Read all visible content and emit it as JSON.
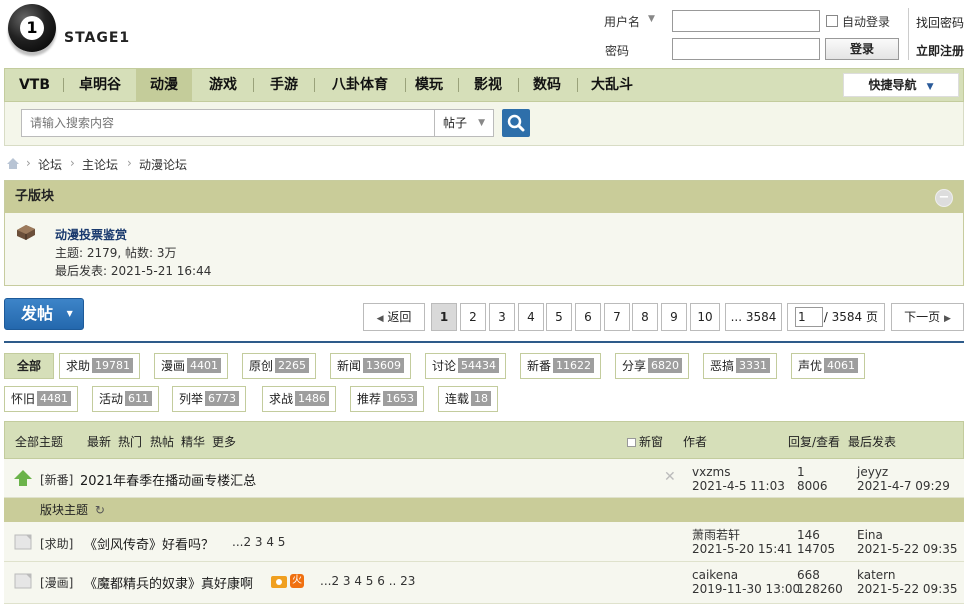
{
  "header": {
    "logo_text": "STAGE1",
    "logo_mark": "1",
    "username_label": "用户名",
    "password_label": "密码",
    "auto_login": "自动登录",
    "login_button": "登录",
    "find_password": "找回密码",
    "register": "立即注册"
  },
  "nav": {
    "items": [
      "VTB",
      "卓明谷",
      "动漫",
      "游戏",
      "手游",
      "八卦体育",
      "模玩",
      "影视",
      "数码",
      "大乱斗"
    ],
    "active": "动漫",
    "quick_nav": "快捷导航"
  },
  "search": {
    "placeholder": "请输入搜索内容",
    "type": "帖子"
  },
  "breadcrumb": [
    "论坛",
    "主论坛",
    "动漫论坛"
  ],
  "subforum": {
    "header": "子版块",
    "collapse": "−",
    "name": "动漫投票鉴赏",
    "stats": "主题: 2179, 帖数: 3万",
    "last_post": "最后发表: 2021-5-21 16:44"
  },
  "post_button": "发帖",
  "pagination": {
    "back": "返回",
    "pages": [
      "1",
      "2",
      "3",
      "4",
      "5",
      "6",
      "7",
      "8",
      "9",
      "10"
    ],
    "last": "... 3584",
    "current": "1",
    "total": "/ 3584 页",
    "next": "下一页"
  },
  "categories": [
    {
      "label": "全部",
      "count": ""
    },
    {
      "label": "求助",
      "count": "19781"
    },
    {
      "label": "漫画",
      "count": "4401"
    },
    {
      "label": "原创",
      "count": "2265"
    },
    {
      "label": "新闻",
      "count": "13609"
    },
    {
      "label": "讨论",
      "count": "54434"
    },
    {
      "label": "新番",
      "count": "11622"
    },
    {
      "label": "分享",
      "count": "6820"
    },
    {
      "label": "恶搞",
      "count": "3331"
    },
    {
      "label": "声优",
      "count": "4061"
    },
    {
      "label": "怀旧",
      "count": "4481"
    },
    {
      "label": "活动",
      "count": "611"
    },
    {
      "label": "列举",
      "count": "6773"
    },
    {
      "label": "求战",
      "count": "1486"
    },
    {
      "label": "推荐",
      "count": "1653"
    },
    {
      "label": "连载",
      "count": "18"
    }
  ],
  "table_header": {
    "all_threads": "全部主题",
    "filters": [
      "最新",
      "热门",
      "热帖",
      "精华",
      "更多"
    ],
    "new_window": "新窗",
    "author": "作者",
    "reply_view": "回复/查看",
    "last_post": "最后发表"
  },
  "section_band": "版块主题",
  "threads": [
    {
      "tag": "[新番]",
      "title": "2021年春季在播动画专楼汇总",
      "pages": "",
      "author": "vxzms",
      "date": "2021-4-5 11:03",
      "replies": "1",
      "views": "8006",
      "last_user": "jeyyz",
      "last_date": "2021-4-7 09:29"
    },
    {
      "tag": "[求助]",
      "title": "《剑风传奇》好看吗？",
      "pages": "...2 3 4 5",
      "author": "萧雨若轩",
      "date": "2021-5-20 15:41",
      "replies": "146",
      "views": "14705",
      "last_user": "Eina",
      "last_date": "2021-5-22 09:35"
    },
    {
      "tag": "[漫画]",
      "title": "《魔都精兵的奴隶》真好康啊",
      "pages": "...2 3 4 5 6 .. 23",
      "author": "caikena",
      "date": "2019-11-30 13:00",
      "replies": "668",
      "views": "128260",
      "last_user": "katern",
      "last_date": "2021-5-22 09:35",
      "hot_badge": "火"
    }
  ]
}
